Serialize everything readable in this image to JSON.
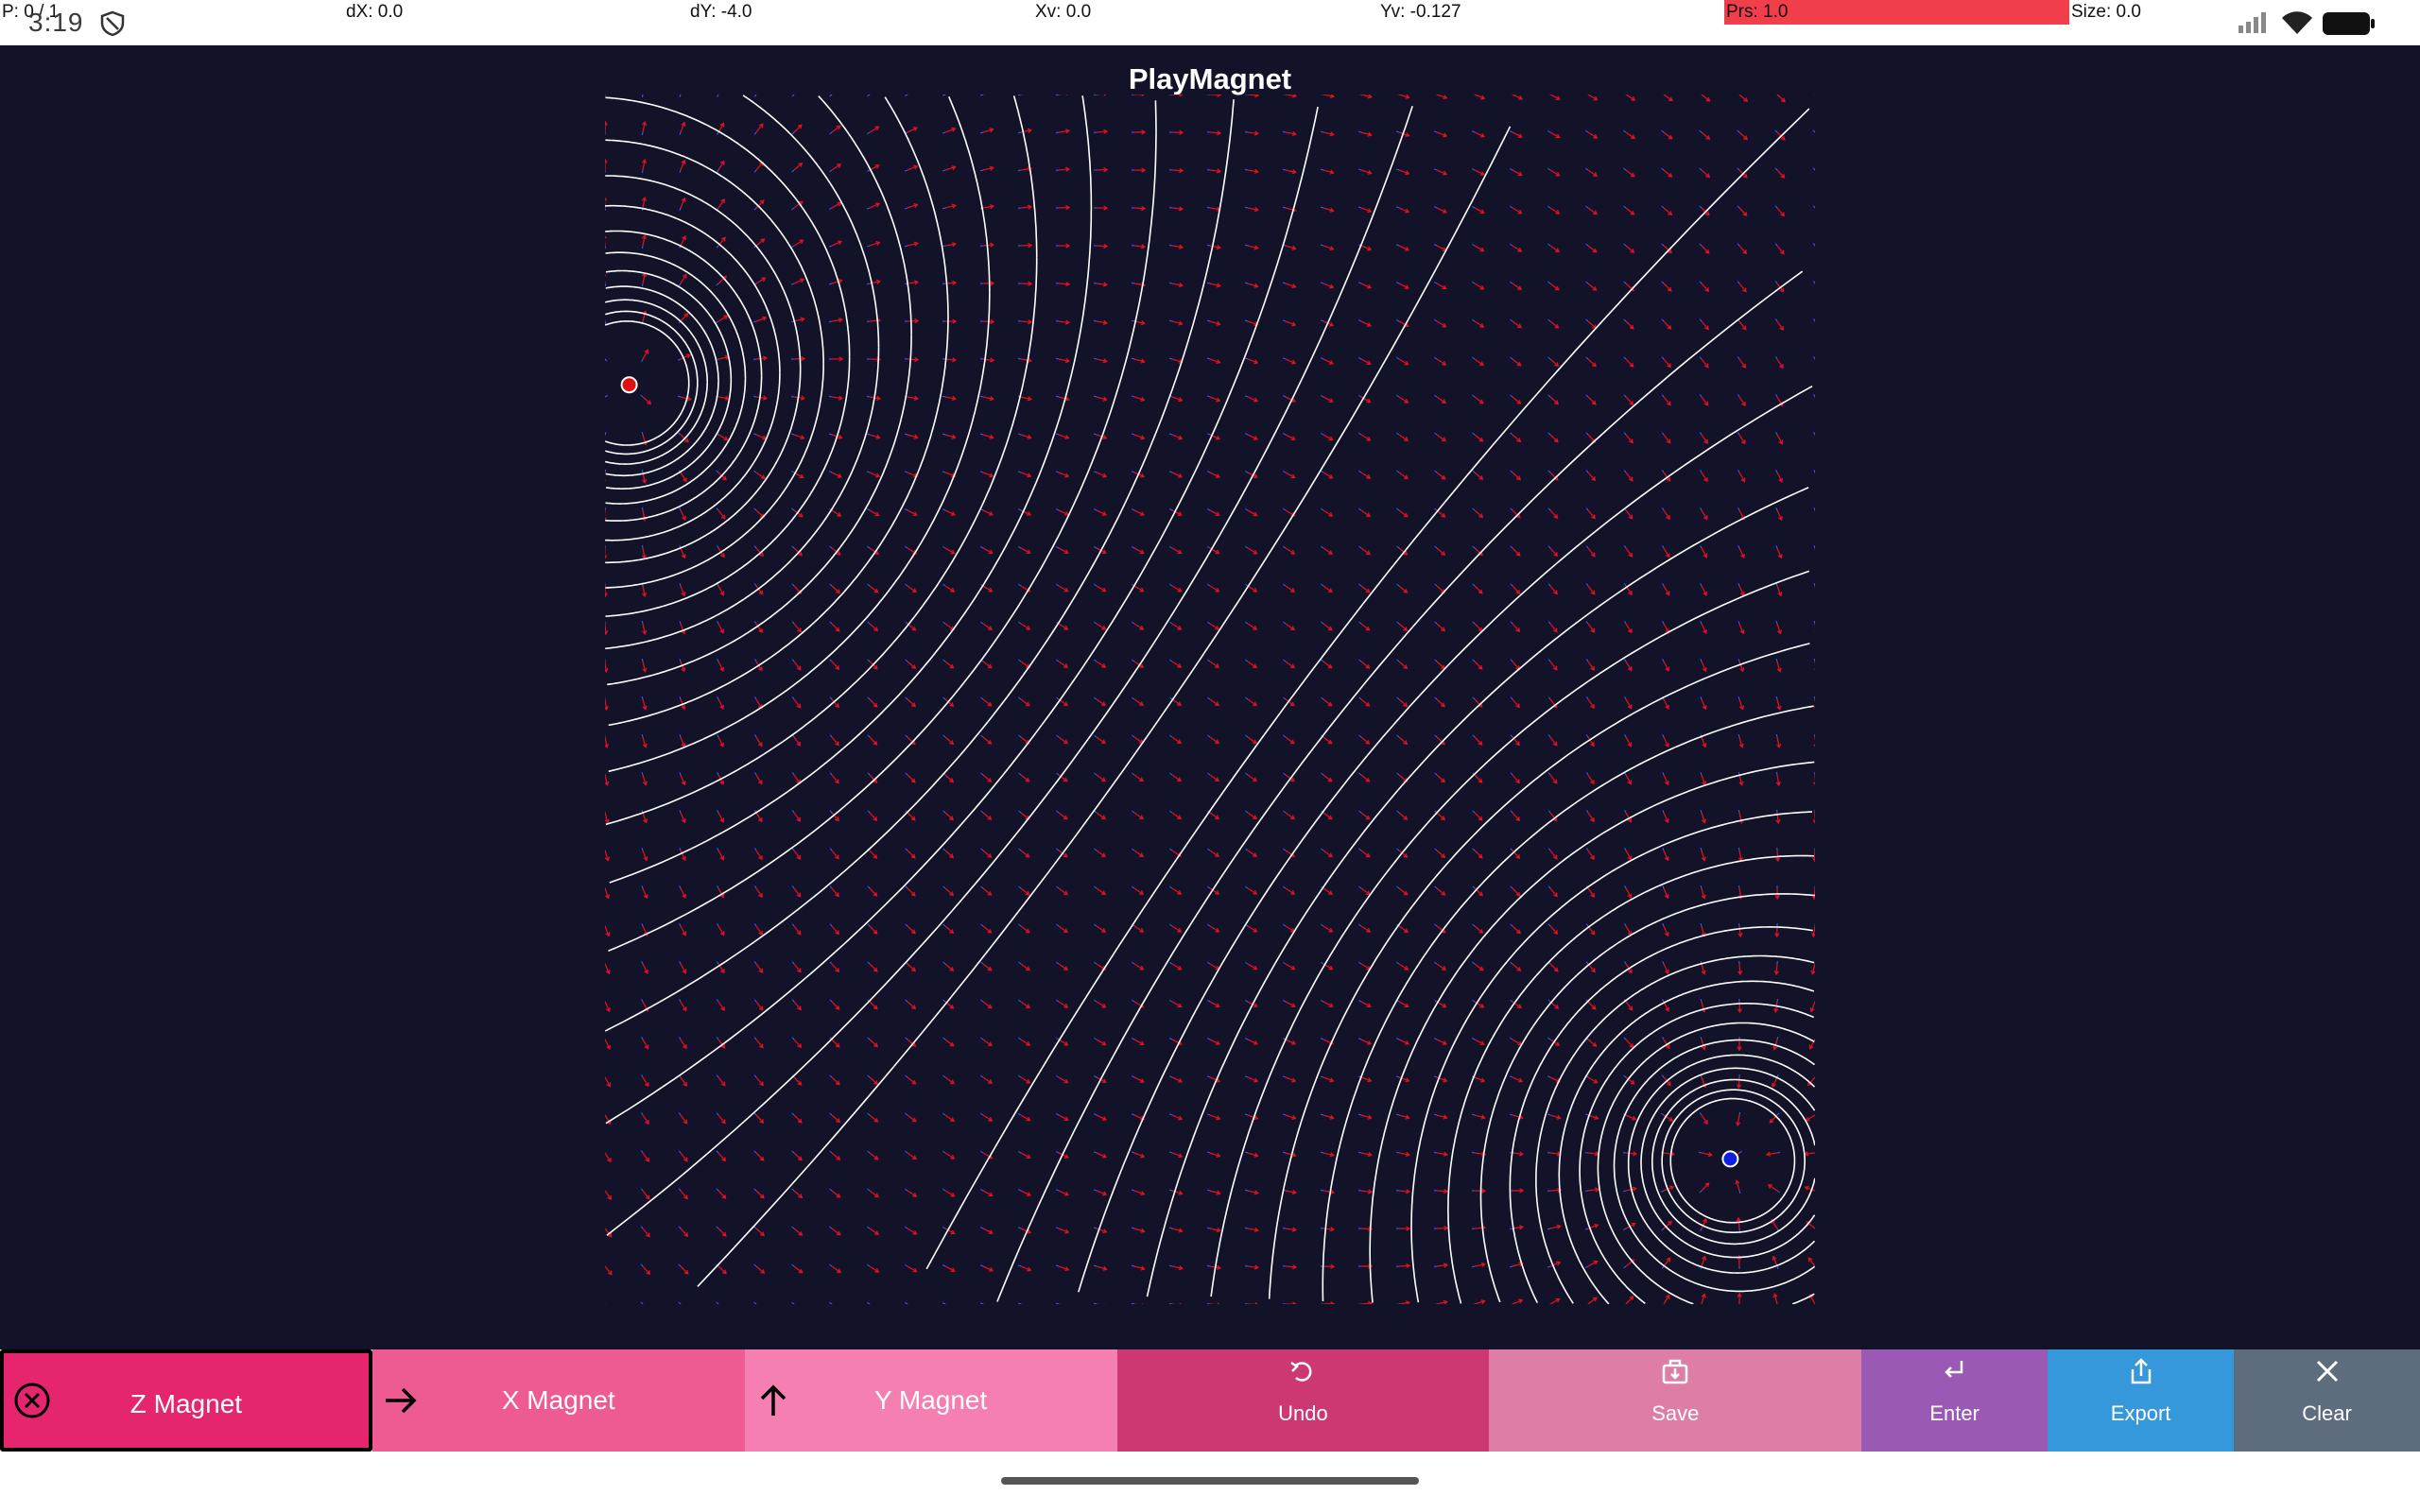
{
  "status": {
    "p": "P: 0 / 1",
    "dx": "dX: 0.0",
    "dy": "dY: -4.0",
    "xv": "Xv: 0.0",
    "yv": "Yv: -0.127",
    "prs": "Prs: 1.0",
    "size": "Size: 0.0",
    "clock": "3:19",
    "pressure_color": "#f03e4a"
  },
  "app": {
    "title": "PlayMagnet",
    "background": "#121228"
  },
  "field": {
    "magnets": [
      {
        "name": "north",
        "color": "#e01010",
        "x": -0.96,
        "y": 0.52
      },
      {
        "name": "south",
        "color": "#1020e0",
        "x": 0.86,
        "y": -0.76
      }
    ],
    "line_color": "#ffffff",
    "arrow_color": "#e01020",
    "arrow_tail_color": "#4060ff"
  },
  "toolbar": {
    "z_magnet": "Z Magnet",
    "x_magnet": "X Magnet",
    "y_magnet": "Y Magnet",
    "undo": "Undo",
    "save": "Save",
    "enter": "Enter",
    "export": "Export",
    "clear": "Clear",
    "colors": {
      "z": "#e5266f",
      "x": "#ee5a92",
      "y": "#f57fb1",
      "undo": "#cd3872",
      "save": "#de7ea6",
      "enter": "#9b59b6",
      "export": "#3498db",
      "clear": "#5d6d7e"
    },
    "icons": {
      "z": "close-circle-icon",
      "x": "arrow-right-icon",
      "y": "arrow-up-icon",
      "undo": "undo-icon",
      "save": "save-icon",
      "enter": "enter-icon",
      "export": "export-icon",
      "clear": "close-icon"
    }
  }
}
